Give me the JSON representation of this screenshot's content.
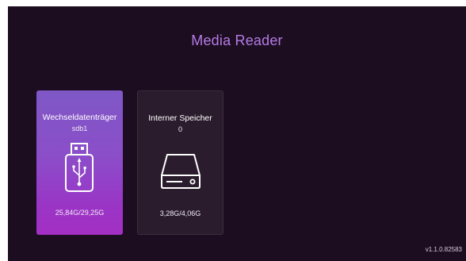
{
  "app": {
    "title": "Media Reader",
    "version": "v1.1.0.82583"
  },
  "devices": [
    {
      "label": "Wechseldatenträger",
      "id": "sdb1",
      "usage": "25,84G/29,25G",
      "icon": "usb-stick-icon",
      "selected": true
    },
    {
      "label": "Interner Speicher",
      "id": "0",
      "usage": "3,28G/4,06G",
      "icon": "hard-drive-icon",
      "selected": false
    }
  ],
  "colors": {
    "background": "#1d0d20",
    "title": "#b57ce6",
    "selected_card": "#8b4ec9",
    "card": "#2a1c2c"
  }
}
